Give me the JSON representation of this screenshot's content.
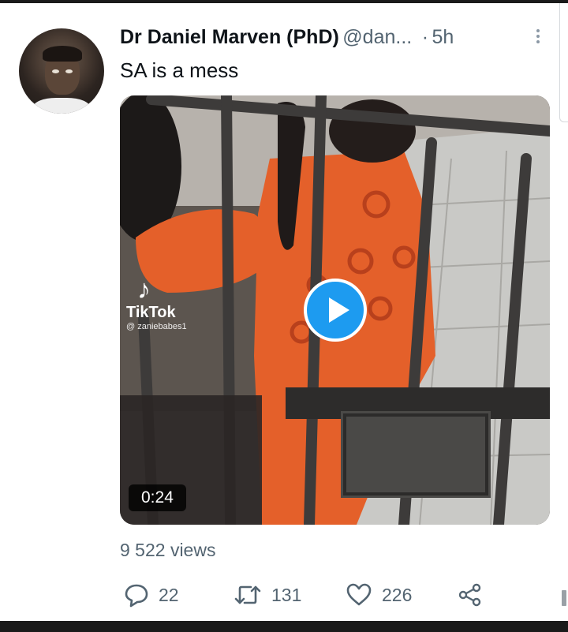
{
  "tweet": {
    "author_name": "Dr Daniel Marven (PhD)",
    "author_handle": "@dan...",
    "separator": "·",
    "time": "5h",
    "text": "SA is a mess",
    "views": "9 522 views"
  },
  "video": {
    "duration": "0:24",
    "watermark_brand": "TikTok",
    "watermark_user": "@ zaniebabes1"
  },
  "actions": {
    "reply_count": "22",
    "retweet_count": "131",
    "like_count": "226"
  },
  "icons": [
    "more-vertical-icon",
    "play-icon",
    "tiktok-icon",
    "reply-icon",
    "retweet-icon",
    "like-icon",
    "share-icon"
  ],
  "colors": {
    "accent": "#1d9bf0",
    "text": "#0f1419",
    "secondary": "#536471",
    "uniform": "#e4602a"
  }
}
